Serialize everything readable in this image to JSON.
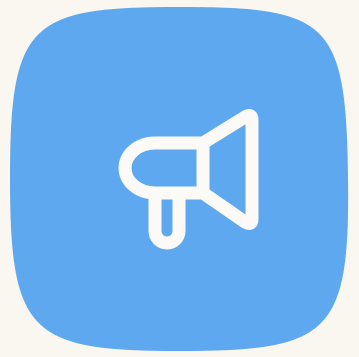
{
  "icon": {
    "name": "megaphone-icon",
    "background_color": "#faf6f0",
    "tile_color": "#5da8ee",
    "glyph_color": "#fbfaf7"
  }
}
